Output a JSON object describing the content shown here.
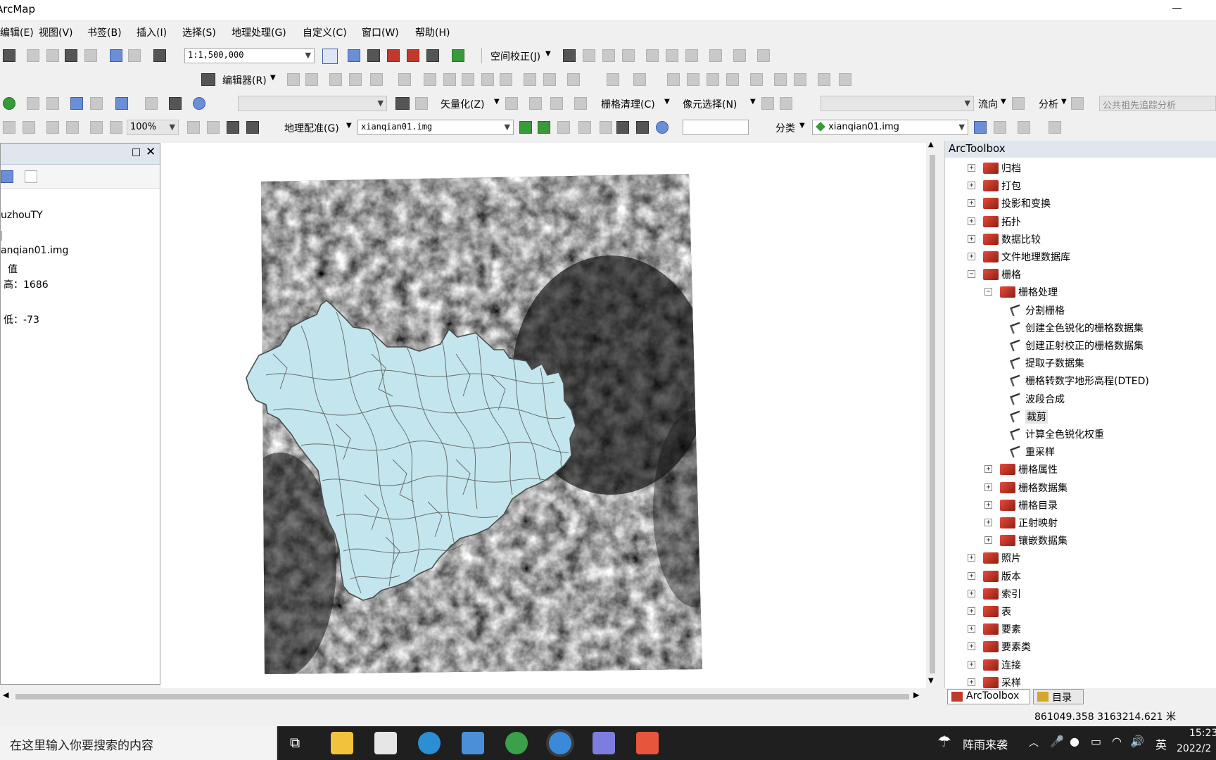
{
  "window": {
    "title": "ArcMap"
  },
  "menu": [
    "编辑(E)",
    "视图(V)",
    "书签(B)",
    "插入(I)",
    "选择(S)",
    "地理处理(G)",
    "自定义(C)",
    "窗口(W)",
    "帮助(H)"
  ],
  "toolbar": {
    "scale": "1:1,500,000",
    "spatial_adjust": "空间校正(J)",
    "editor": "编辑器(R)",
    "vectorize": "矢量化(Z)",
    "raster_cleanup": "栅格清理(C)",
    "cell_select": "像元选择(N)",
    "flow": "流向",
    "analysis": "分析",
    "trace_analysis": "公共祖先追踪分析",
    "zoom": "100%",
    "georeference": "地理配准(G)",
    "georef_layer": "xianqian01.img",
    "classify": "分类",
    "classify_layer": "xianqian01.img"
  },
  "toc": {
    "items": [
      "uzhouTY",
      "anqian01.img",
      "值",
      "高：1686",
      "低：-73"
    ]
  },
  "arctoolbox": {
    "title": "ArcToolbox",
    "items": [
      {
        "label": "归档",
        "level": 0,
        "type": "toolbox",
        "expanded": false
      },
      {
        "label": "打包",
        "level": 0,
        "type": "toolbox",
        "expanded": false
      },
      {
        "label": "投影和变换",
        "level": 0,
        "type": "toolbox",
        "expanded": false
      },
      {
        "label": "拓扑",
        "level": 0,
        "type": "toolbox",
        "expanded": false
      },
      {
        "label": "数据比较",
        "level": 0,
        "type": "toolbox",
        "expanded": false
      },
      {
        "label": "文件地理数据库",
        "level": 0,
        "type": "toolbox",
        "expanded": false
      },
      {
        "label": "栅格",
        "level": 0,
        "type": "toolbox",
        "expanded": true
      },
      {
        "label": "栅格处理",
        "level": 1,
        "type": "toolbox",
        "expanded": true
      },
      {
        "label": "分割栅格",
        "level": 2,
        "type": "tool"
      },
      {
        "label": "创建全色锐化的栅格数据集",
        "level": 2,
        "type": "tool"
      },
      {
        "label": "创建正射校正的栅格数据集",
        "level": 2,
        "type": "tool"
      },
      {
        "label": "提取子数据集",
        "level": 2,
        "type": "tool"
      },
      {
        "label": "栅格转数字地形高程(DTED)",
        "level": 2,
        "type": "tool"
      },
      {
        "label": "波段合成",
        "level": 2,
        "type": "tool"
      },
      {
        "label": "裁剪",
        "level": 2,
        "type": "tool",
        "selected": true
      },
      {
        "label": "计算全色锐化权重",
        "level": 2,
        "type": "tool"
      },
      {
        "label": "重采样",
        "level": 2,
        "type": "tool"
      },
      {
        "label": "栅格属性",
        "level": 1,
        "type": "toolbox",
        "expanded": false
      },
      {
        "label": "栅格数据集",
        "level": 1,
        "type": "toolbox",
        "expanded": false
      },
      {
        "label": "栅格目录",
        "level": 1,
        "type": "toolbox",
        "expanded": false
      },
      {
        "label": "正射映射",
        "level": 1,
        "type": "toolbox",
        "expanded": false
      },
      {
        "label": "镶嵌数据集",
        "level": 1,
        "type": "toolbox",
        "expanded": false
      },
      {
        "label": "照片",
        "level": 0,
        "type": "toolbox",
        "expanded": false
      },
      {
        "label": "版本",
        "level": 0,
        "type": "toolbox",
        "expanded": false
      },
      {
        "label": "索引",
        "level": 0,
        "type": "toolbox",
        "expanded": false
      },
      {
        "label": "表",
        "level": 0,
        "type": "toolbox",
        "expanded": false
      },
      {
        "label": "要素",
        "level": 0,
        "type": "toolbox",
        "expanded": false
      },
      {
        "label": "要素类",
        "level": 0,
        "type": "toolbox",
        "expanded": false
      },
      {
        "label": "连接",
        "level": 0,
        "type": "toolbox",
        "expanded": false
      },
      {
        "label": "采样",
        "level": 0,
        "type": "toolbox",
        "expanded": false
      }
    ],
    "tabs": [
      "ArcToolbox",
      "目录"
    ]
  },
  "status": {
    "coords": "861049.358  3163214.621 米"
  },
  "taskbar": {
    "search_placeholder": "在这里输入你要搜索的内容",
    "weather": "阵雨来袭",
    "ime": "英",
    "time": "15:23",
    "date": "2022/2"
  },
  "colors": {
    "dem_overlay": "#c3e6ee",
    "overlay_border": "#5a5a5a",
    "panel_header": "#dfe6ee"
  }
}
